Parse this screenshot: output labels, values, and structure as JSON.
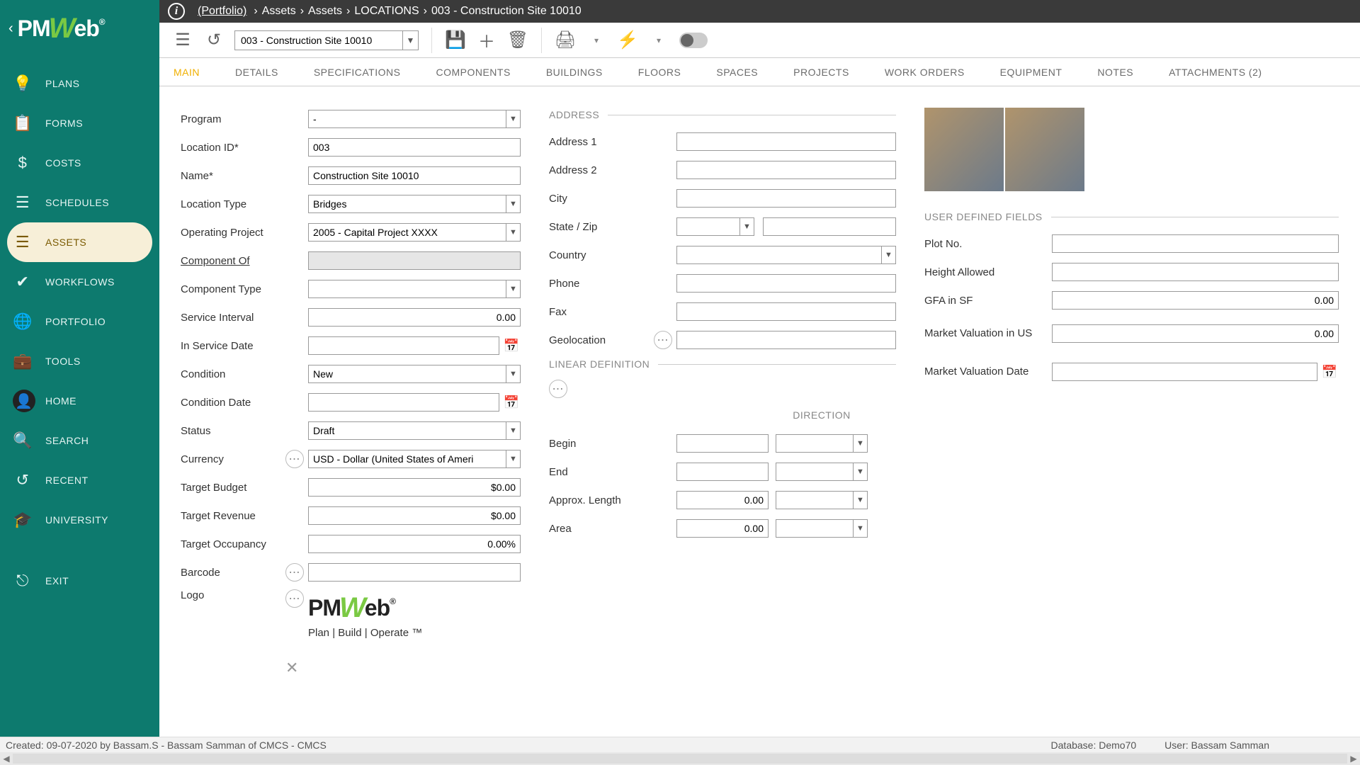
{
  "breadcrumb": {
    "portfolio": "(Portfolio)",
    "p1": "Assets",
    "p2": "Assets",
    "p3": "LOCATIONS",
    "p4": "003 - Construction Site 10010"
  },
  "record_selector": "003 - Construction Site 10010",
  "tabs": {
    "main": "MAIN",
    "details": "DETAILS",
    "specs": "SPECIFICATIONS",
    "components": "COMPONENTS",
    "buildings": "BUILDINGS",
    "floors": "FLOORS",
    "spaces": "SPACES",
    "projects": "PROJECTS",
    "workorders": "WORK ORDERS",
    "equipment": "EQUIPMENT",
    "notes": "NOTES",
    "attachments": "ATTACHMENTS (2)"
  },
  "sidebar": {
    "plans": "PLANS",
    "forms": "FORMS",
    "costs": "COSTS",
    "schedules": "SCHEDULES",
    "assets": "ASSETS",
    "workflows": "WORKFLOWS",
    "portfolio": "PORTFOLIO",
    "tools": "TOOLS",
    "home": "HOME",
    "search": "SEARCH",
    "recent": "RECENT",
    "university": "UNIVERSITY",
    "exit": "EXIT"
  },
  "labels": {
    "program": "Program",
    "location_id": "Location ID*",
    "name": "Name*",
    "location_type": "Location Type",
    "operating_project": "Operating Project",
    "component_of": "Component Of",
    "component_type": "Component Type",
    "service_interval": "Service Interval",
    "in_service_date": "In Service Date",
    "condition": "Condition",
    "condition_date": "Condition Date",
    "status": "Status",
    "currency": "Currency",
    "target_budget": "Target Budget",
    "target_revenue": "Target Revenue",
    "target_occupancy": "Target Occupancy",
    "barcode": "Barcode",
    "logo": "Logo",
    "address_hdr": "ADDRESS",
    "address1": "Address 1",
    "address2": "Address 2",
    "city": "City",
    "state_zip": "State / Zip",
    "country": "Country",
    "phone": "Phone",
    "fax": "Fax",
    "geolocation": "Geolocation",
    "lindef_hdr": "LINEAR DEFINITION",
    "direction": "DIRECTION",
    "begin": "Begin",
    "end": "End",
    "approx_length": "Approx. Length",
    "area": "Area",
    "udf_hdr": "USER DEFINED FIELDS",
    "plot_no": "Plot No.",
    "height_allowed": "Height Allowed",
    "gfa": "GFA in SF",
    "market_val_us": "Market Valuation in US",
    "market_val_date": "Market Valuation Date"
  },
  "values": {
    "program": "-",
    "location_id": "003",
    "name": "Construction Site 10010",
    "location_type": "Bridges",
    "operating_project": "2005 - Capital Project XXXX",
    "component_of": "",
    "component_type": "",
    "service_interval": "0.00",
    "in_service_date": "",
    "condition": "New",
    "condition_date": "",
    "status": "Draft",
    "currency": "USD - Dollar (United States of Ameri",
    "target_budget": "$0.00",
    "target_revenue": "$0.00",
    "target_occupancy": "0.00%",
    "barcode": "",
    "address1": "",
    "address2": "",
    "city": "",
    "state": "",
    "zip": "",
    "country": "",
    "phone": "",
    "fax": "",
    "geolocation": "",
    "begin_val": "",
    "begin_dir": "",
    "end_val": "",
    "end_dir": "",
    "approx_length": "0.00",
    "approx_unit": "",
    "area_val": "0.00",
    "area_unit": "",
    "plot_no": "",
    "height_allowed": "",
    "gfa": "0.00",
    "market_val_us": "0.00",
    "market_val_date": ""
  },
  "status": {
    "created": "Created:  09-07-2020 by Bassam.S - Bassam Samman of CMCS - CMCS",
    "db_label": "Database:",
    "db_val": "Demo70",
    "user_label": "User:",
    "user_val": "Bassam Samman"
  },
  "logo_tagline": "Plan | Build | Operate ™"
}
